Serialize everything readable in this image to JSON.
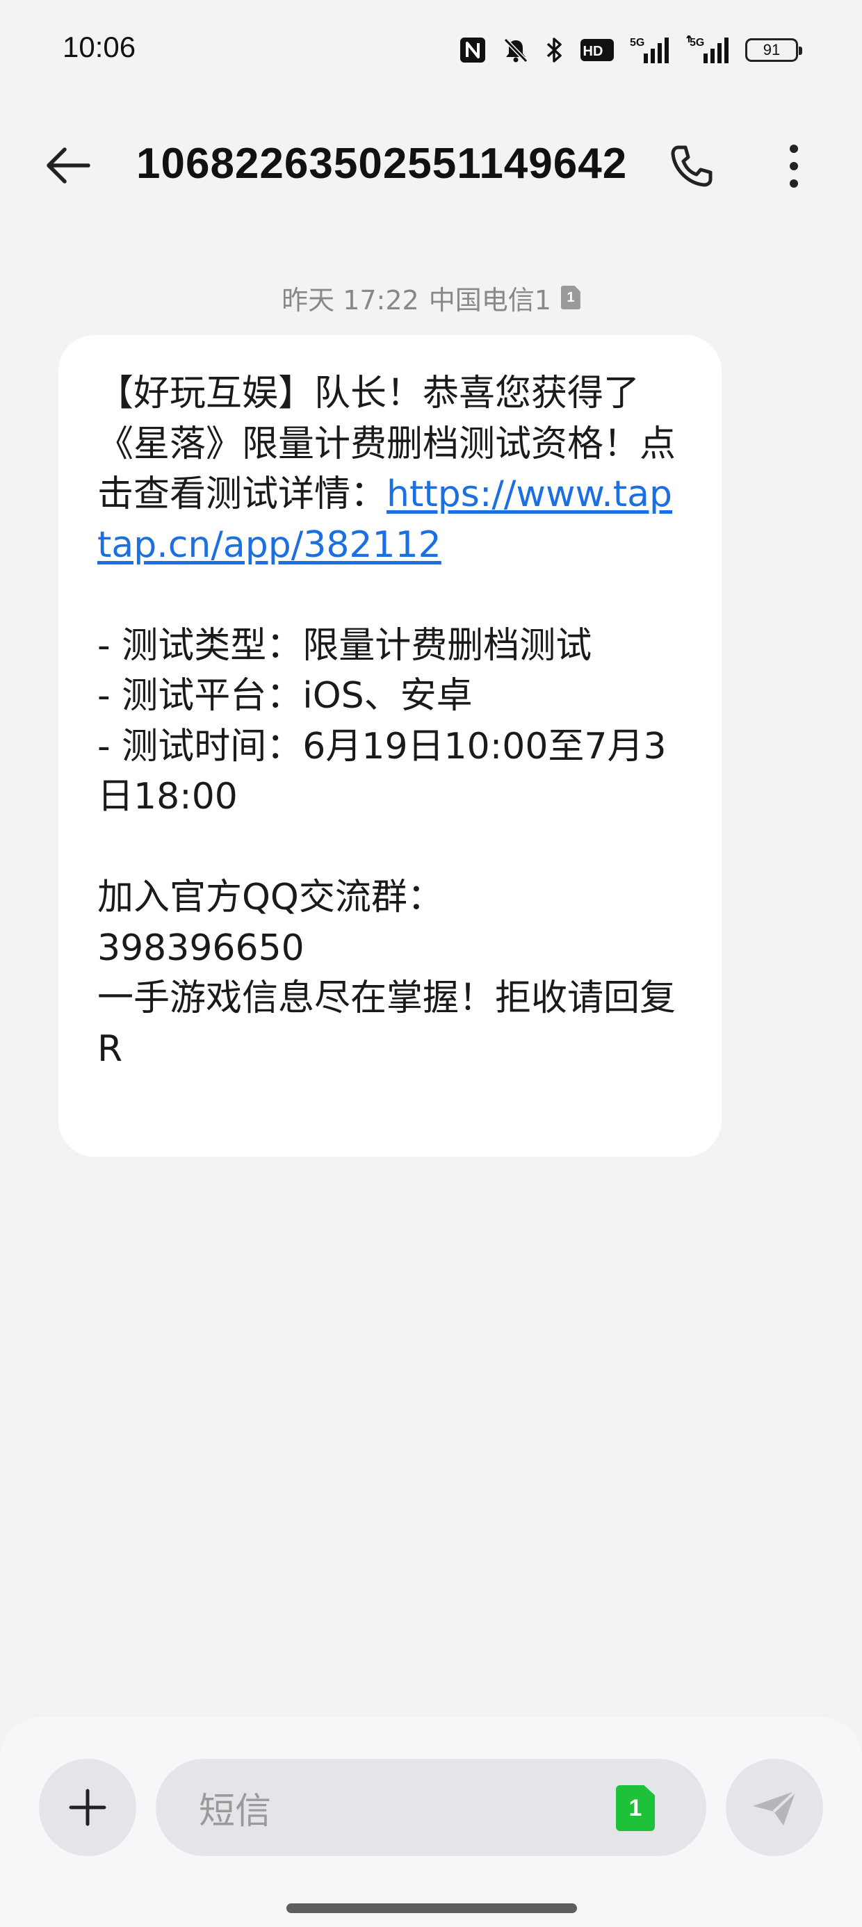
{
  "status_bar": {
    "time": "10:06",
    "battery_level": "91",
    "icons": [
      "nfc-icon",
      "mute-icon",
      "bluetooth-icon",
      "hd-icon",
      "5g-signal-icon",
      "5g-signal-icon"
    ],
    "hd_label": "HD",
    "net_label_1": "5G",
    "net_label_2": "5G"
  },
  "header": {
    "title": "10682263502551149642",
    "back_icon": "arrow-left-icon",
    "call_icon": "phone-icon",
    "more_icon": "more-vertical-icon"
  },
  "conversation": {
    "timestamp": "昨天 17:22",
    "carrier": "中国电信1",
    "sim_badge": "1",
    "message": {
      "intro": "【好玩互娱】队长！恭喜您获得了《星落》限量计费删档测试资格！点击查看测试详情：",
      "link": "https://www.taptap.cn/app/382112",
      "body": "\n\n- 测试类型：限量计费删档测试\n- 测试平台：iOS、安卓\n- 测试时间：6月19日10:00至7月3日18:00\n\n加入官方QQ交流群：\n398396650\n一手游戏信息尽在掌握！拒收请回复R"
    }
  },
  "composer": {
    "placeholder": "短信",
    "sim_select": "1",
    "attach_icon": "plus-icon",
    "send_icon": "send-icon"
  },
  "colors": {
    "background": "#f2f3f5",
    "bubble": "#ffffff",
    "link": "#1c6fe0",
    "sim_green": "#1ec23a"
  }
}
